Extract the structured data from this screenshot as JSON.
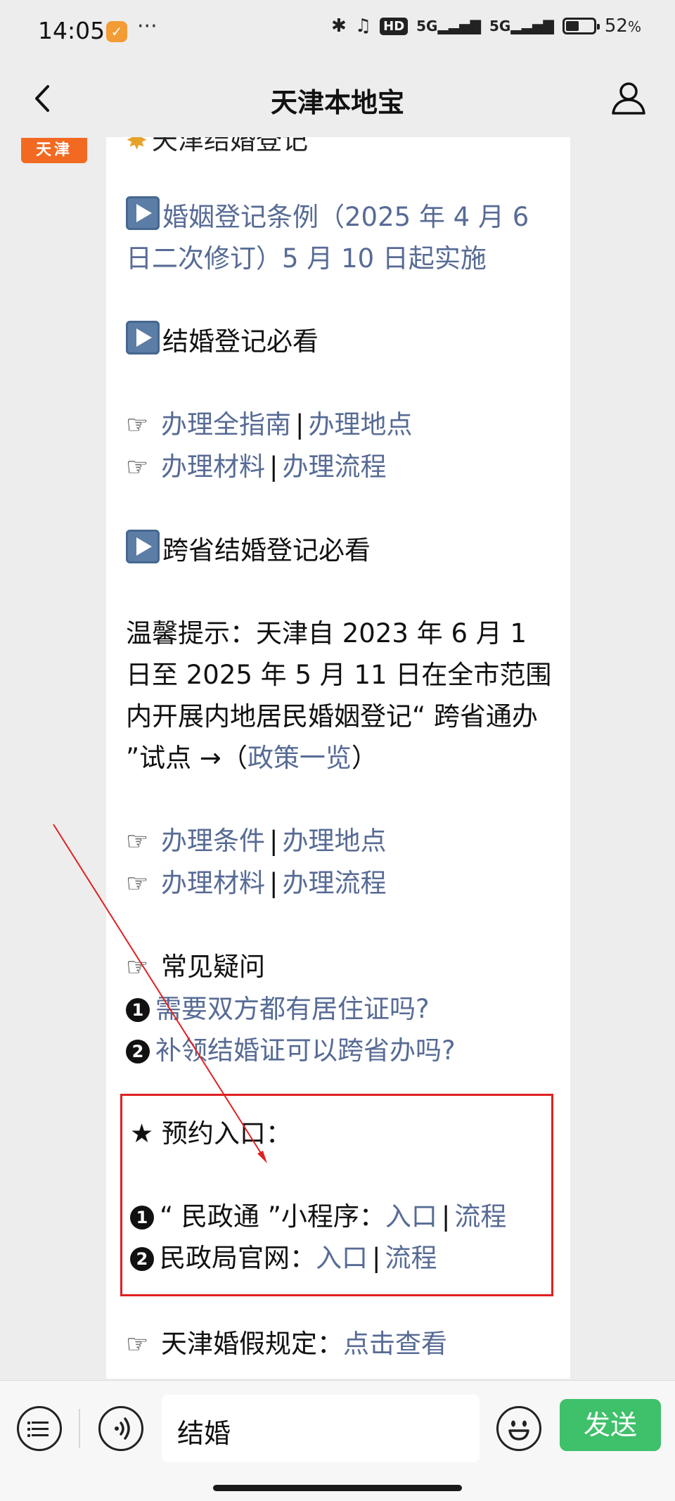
{
  "status": {
    "time": "14:05",
    "battery": "52",
    "battery_unit": "%",
    "network": [
      "5G",
      "5G"
    ],
    "hd": "HD"
  },
  "header": {
    "title": "天津本地宝"
  },
  "tag": "天津",
  "article": {
    "top_partial": "天津结婚登记",
    "sec1": "婚姻登记条例（2025 年 4 月 6 日二次修订）5 月 10 日起实施",
    "sec2": "结婚登记必看",
    "links1": {
      "a": "办理全指南",
      "b": "办理地点",
      "c": "办理材料",
      "d": "办理流程"
    },
    "sec3": "跨省结婚登记必看",
    "tip": {
      "prefix": "温馨提示：天津自 2023 年 6 月 1 日至 2025 年 5 月 11 日在全市范围内开展内地居民婚姻登记“ 跨省通办 ”试点 →（",
      "link": "政策一览",
      "suffix": "）"
    },
    "links2": {
      "a": "办理条件",
      "b": "办理地点",
      "c": "办理材料",
      "d": "办理流程"
    },
    "faq": {
      "title": "常见疑问",
      "q1": "需要双方都有居住证吗?",
      "q2": "补领结婚证可以跨省办吗?"
    },
    "booking": {
      "title": "★ 预约入口：",
      "item1": {
        "label": "“ 民政通 ”小程序：",
        "link1": "入口",
        "link2": "流程"
      },
      "item2": {
        "label": "民政局官网：",
        "link1": "入口",
        "link2": "流程"
      }
    },
    "leave": {
      "label": "天津婚假规定：",
      "link": "点击查看"
    }
  },
  "input": {
    "value": "结婚",
    "send": "发送"
  },
  "icons": {
    "pointer": "☞",
    "num1": "1",
    "num2": "2",
    "sep": "|"
  },
  "colors": {
    "link": "#576b95",
    "send": "#3fc06a",
    "tag": "#f26a21",
    "highlight": "#e02020"
  }
}
